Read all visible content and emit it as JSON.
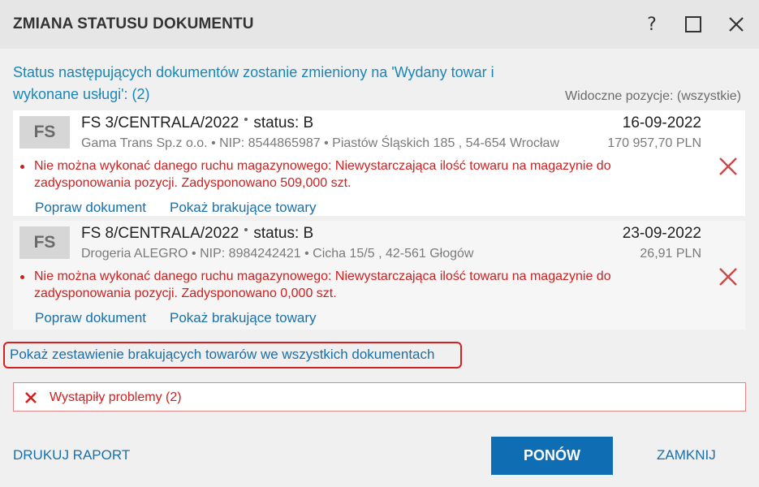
{
  "window": {
    "title": "ZMIANA STATUSU DOKUMENTU",
    "help_label": "?"
  },
  "header": {
    "message": "Status następujących dokumentów zostanie zmieniony na 'Wydany towar i wykonane usługi': (2)",
    "visible_positions": "Widoczne pozycje: (wszystkie)"
  },
  "documents": [
    {
      "badge": "FS",
      "number": "FS 3/CENTRALA/2022",
      "status": "status: B",
      "date": "16-09-2022",
      "details": "Gama Trans Sp.z o.o. • NIP: 8544865987 • Piastów Śląskich 185 , 54-654 Wrocław",
      "amount": "170 957,70 PLN",
      "error": "Nie można wykonać danego ruchu magazynowego: Niewystarczająca ilość towaru na magazynie do zadysponowania pozycji. Zadysponowano 509,000 szt.",
      "link_fix": "Popraw dokument",
      "link_missing": "Pokaż brakujące towary"
    },
    {
      "badge": "FS",
      "number": "FS 8/CENTRALA/2022",
      "status": "status: B",
      "date": "23-09-2022",
      "details": "Drogeria ALEGRO • NIP: 8984242421 • Cicha  15/5 , 42-561 Głogów",
      "amount": "26,91 PLN",
      "error": "Nie można wykonać danego ruchu magazynowego: Niewystarczająca ilość towaru na magazynie do zadysponowania pozycji. Zadysponowano 0,000 szt.",
      "link_fix": "Popraw dokument",
      "link_missing": "Pokaż brakujące towary"
    }
  ],
  "summary_link": "Pokaż zestawienie brakujących towarów we wszystkich dokumentach",
  "problems": {
    "text": "Wystąpiły problemy (2)"
  },
  "footer": {
    "print_label": "DRUKUJ RAPORT",
    "retry_label": "PONÓW",
    "close_label": "ZAMKNIJ"
  },
  "colors": {
    "accent": "#0f6eb3",
    "link": "#1a6fa8",
    "error": "#d01f1f",
    "headline": "#1a86b8"
  },
  "icons": {
    "help": "help-icon",
    "maximize": "maximize-icon",
    "close": "close-icon",
    "error_x": "error-x-icon"
  }
}
